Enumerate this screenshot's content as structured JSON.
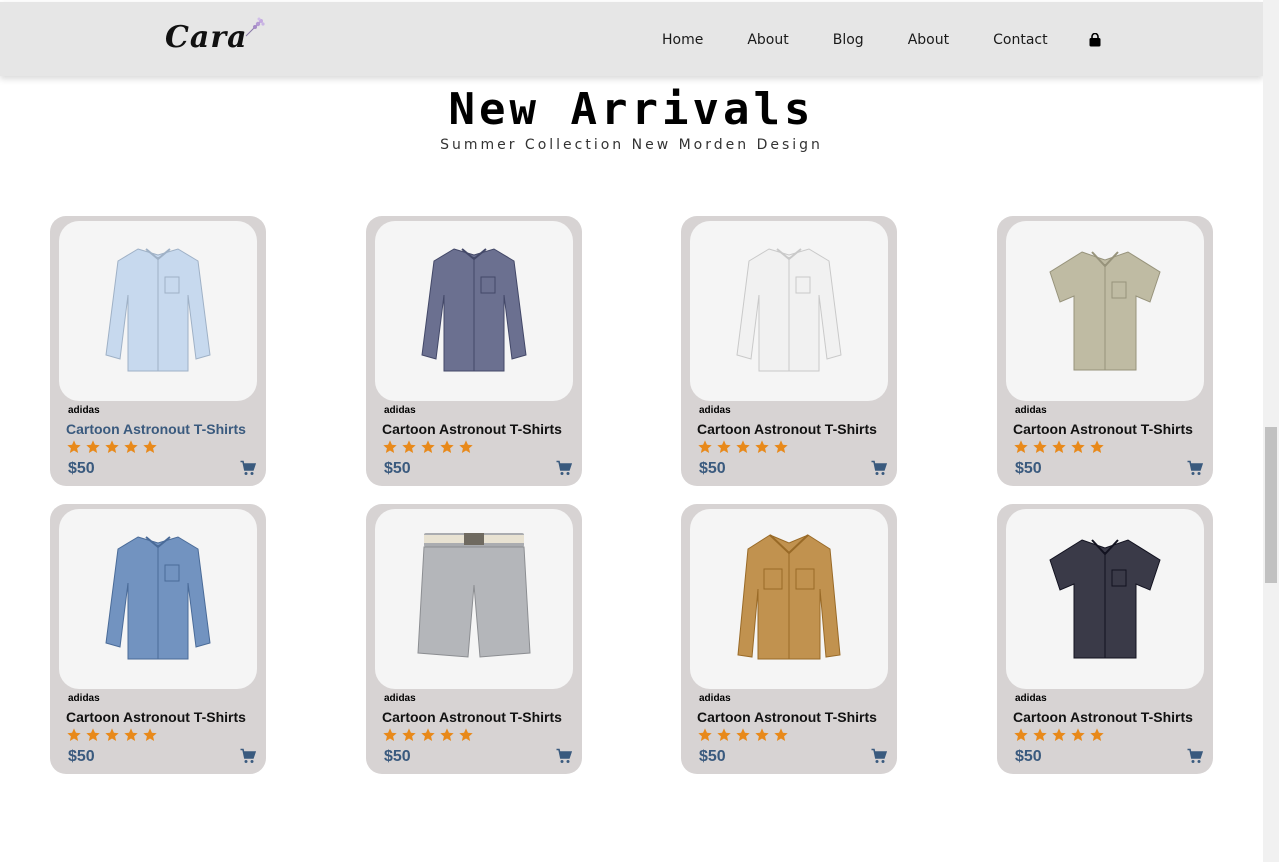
{
  "header": {
    "logo_text": "Cara",
    "nav": [
      {
        "label": "Home"
      },
      {
        "label": "About"
      },
      {
        "label": "Blog"
      },
      {
        "label": "About"
      },
      {
        "label": "Contact"
      }
    ],
    "icons": {
      "cart": "shopping-bag-icon"
    }
  },
  "section": {
    "title": "New Arrivals",
    "subtitle": "Summer Collection New Morden Design"
  },
  "products": [
    {
      "brand": "adidas",
      "name": "Cartoon Astronout T-Shirts",
      "price": "$50",
      "rating": 5,
      "garment": "long-sleeve-shirt",
      "color": "#c7d9ee"
    },
    {
      "brand": "adidas",
      "name": "Cartoon Astronout T-Shirts",
      "price": "$50",
      "rating": 5,
      "garment": "long-sleeve-shirt",
      "color": "#6b7090"
    },
    {
      "brand": "adidas",
      "name": "Cartoon Astronout T-Shirts",
      "price": "$50",
      "rating": 5,
      "garment": "long-sleeve-shirt",
      "color": "#f1f1f1"
    },
    {
      "brand": "adidas",
      "name": "Cartoon Astronout T-Shirts",
      "price": "$50",
      "rating": 5,
      "garment": "short-sleeve-shirt",
      "color": "#bfbba3"
    },
    {
      "brand": "adidas",
      "name": "Cartoon Astronout T-Shirts",
      "price": "$50",
      "rating": 5,
      "garment": "long-sleeve-shirt",
      "color": "#7293c0"
    },
    {
      "brand": "adidas",
      "name": "Cartoon Astronout T-Shirts",
      "price": "$50",
      "rating": 5,
      "garment": "shorts",
      "color": "#b4b6ba"
    },
    {
      "brand": "adidas",
      "name": "Cartoon Astronout T-Shirts",
      "price": "$50",
      "rating": 5,
      "garment": "jacket",
      "color": "#c1924f"
    },
    {
      "brand": "adidas",
      "name": "Cartoon Astronout T-Shirts",
      "price": "$50",
      "rating": 5,
      "garment": "short-sleeve-shirt",
      "color": "#3a3a48"
    }
  ],
  "colors": {
    "header_bg": "#e6e6e6",
    "card_bg": "#d7d3d3",
    "star": "#e8891a",
    "price": "#3a5a7e"
  }
}
